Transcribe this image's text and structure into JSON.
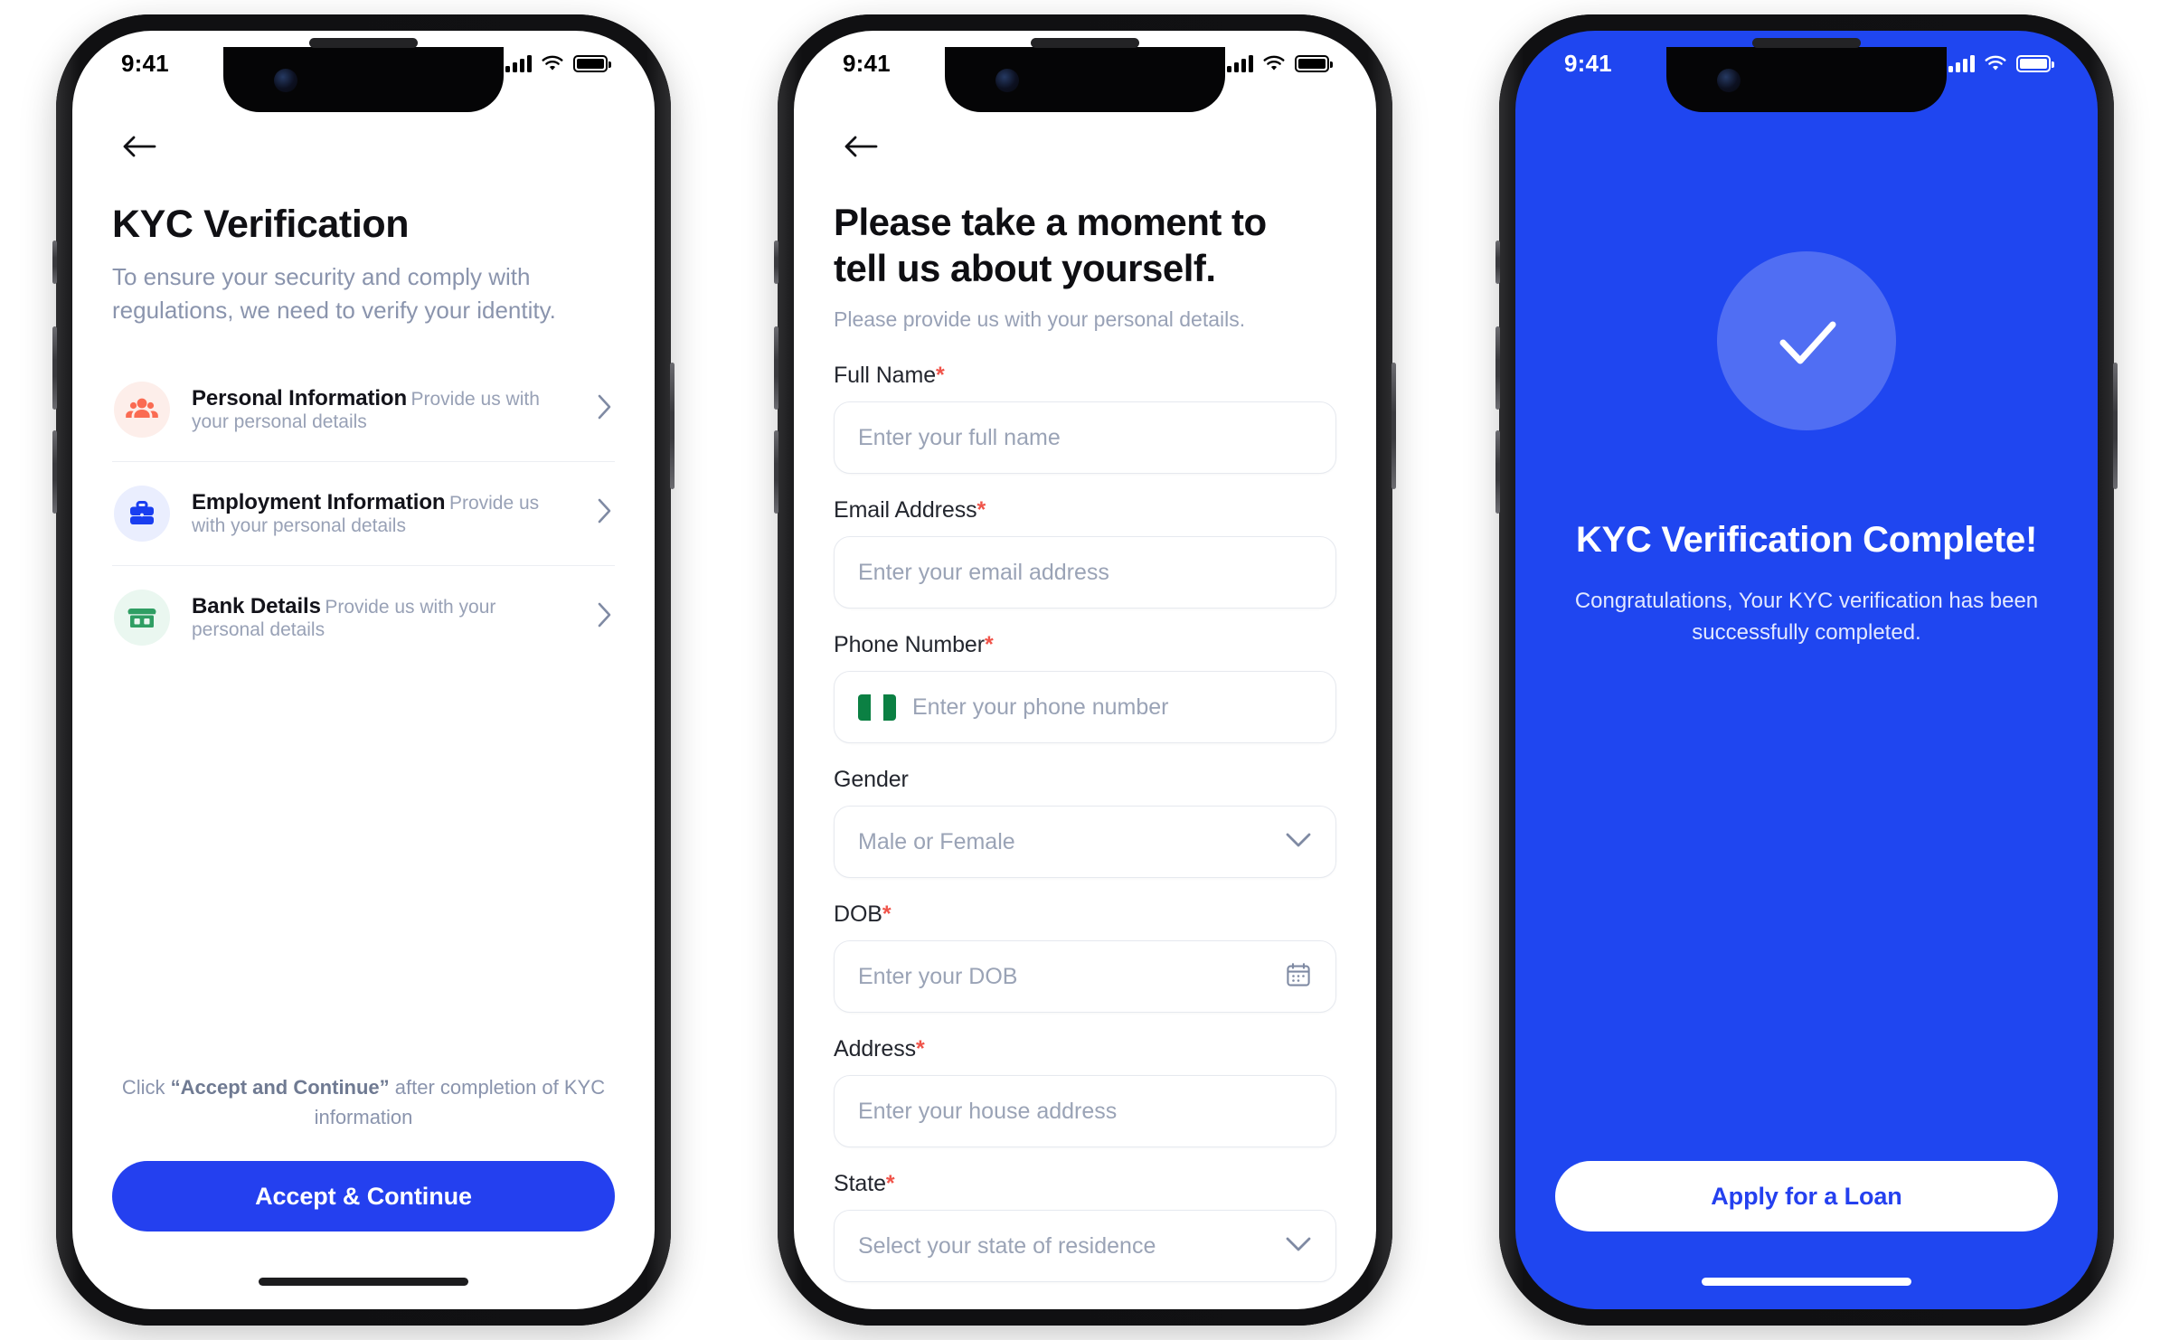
{
  "screens": [
    {
      "id": "kyc-verification",
      "statusbar": {
        "time": "9:41",
        "signal_icon": "cellular-bars-icon",
        "wifi_icon": "wifi-icon",
        "battery_icon": "battery-full-icon"
      },
      "back_icon": "arrow-left-icon",
      "title": "KYC Verification",
      "subtitle": "To ensure your security and comply with regulations, we need to verify your identity.",
      "items": [
        {
          "name": "Personal Information",
          "desc": "Provide us with your personal details",
          "icon": "people-group-icon",
          "icon_color": "#fa6b52",
          "icon_bg": "#fdeeea"
        },
        {
          "name": "Employment Information",
          "desc": "Provide us with your personal details",
          "icon": "briefcase-icon",
          "icon_color": "#1a3ef0",
          "icon_bg": "#eaeefe"
        },
        {
          "name": "Bank Details",
          "desc": "Provide us with your personal details",
          "icon": "bank-storefront-icon",
          "icon_color": "#2f9e63",
          "icon_bg": "#eaf7f0"
        }
      ],
      "chevron_icon": "chevron-right-icon",
      "footer_note_prefix": "Click ",
      "footer_note_bold": "“Accept and Continue”",
      "footer_note_suffix": " after completion of KYC information",
      "cta_label": "Accept & Continue",
      "cta_color": "#2440ef"
    },
    {
      "id": "personal-details",
      "statusbar": {
        "time": "9:41",
        "signal_icon": "cellular-bars-icon",
        "wifi_icon": "wifi-icon",
        "battery_icon": "battery-full-icon"
      },
      "back_icon": "arrow-left-icon",
      "title": "Please take a moment to tell us about yourself.",
      "subtitle": "Please provide us with your personal details.",
      "fields": [
        {
          "label": "Full Name",
          "required": true,
          "placeholder": "Enter your full name",
          "trailing_icon": ""
        },
        {
          "label": "Email Address",
          "required": true,
          "placeholder": "Enter your email address",
          "trailing_icon": ""
        },
        {
          "label": "Phone Number",
          "required": true,
          "placeholder": "Enter your phone number",
          "leading_icon": "nigeria-flag-icon",
          "trailing_icon": ""
        },
        {
          "label": "Gender",
          "required": false,
          "placeholder": "Male or Female",
          "trailing_icon": "chevron-down-icon"
        },
        {
          "label": "DOB",
          "required": true,
          "placeholder": "Enter your DOB",
          "trailing_icon": "calendar-icon"
        },
        {
          "label": "Address",
          "required": true,
          "placeholder": "Enter your house address",
          "trailing_icon": ""
        },
        {
          "label": "State",
          "required": true,
          "placeholder": "Select your state of residence",
          "trailing_icon": "chevron-down-icon"
        }
      ],
      "required_marker": "*"
    },
    {
      "id": "kyc-complete",
      "statusbar": {
        "time": "9:41",
        "signal_icon": "cellular-bars-icon",
        "wifi_icon": "wifi-icon",
        "battery_icon": "battery-full-icon"
      },
      "background_color": "#1f46f0",
      "check_icon": "checkmark-icon",
      "title": "KYC Verification Complete!",
      "description": "Congratulations, Your KYC verification has been successfully completed.",
      "cta_label": "Apply for a Loan",
      "cta_text_color": "#2440ef"
    }
  ]
}
